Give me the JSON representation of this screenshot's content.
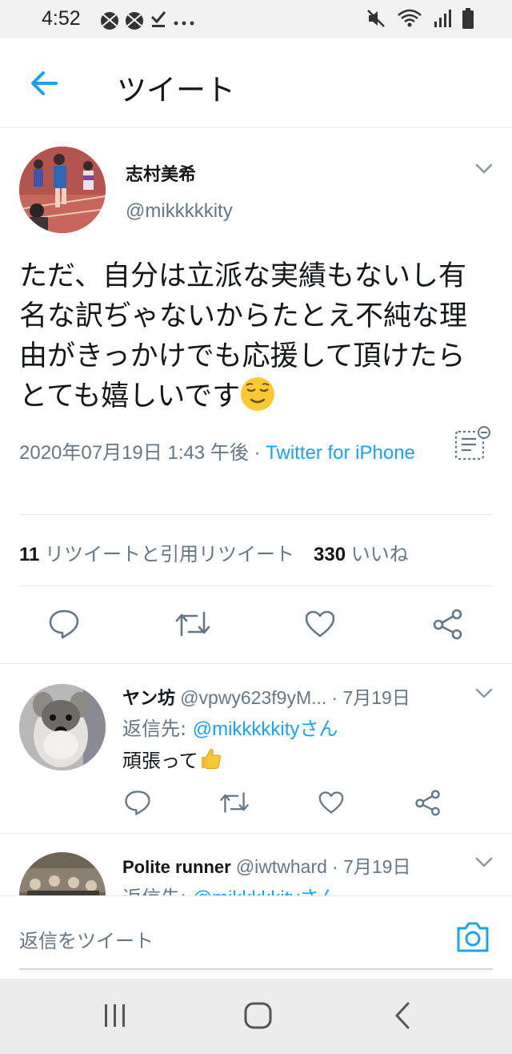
{
  "status_bar": {
    "time": "4:52",
    "icons_left": [
      "soccer-ball-icon",
      "soccer-ball-icon",
      "download-done-icon",
      "more-dots-icon"
    ],
    "icons_right": [
      "mute-icon",
      "wifi-icon",
      "signal-icon",
      "battery-icon"
    ]
  },
  "header": {
    "back_icon": "arrow-left-icon",
    "title": "ツイート",
    "accent_color": "#1da1f2"
  },
  "tweet": {
    "author_name": "志村美希",
    "author_handle": "@mikkkkkity",
    "text": "ただ、自分は立派な実績もないし有名な訳ぢゃないからたとえ不純な理由がきっかけでも応援して頂けたらとても嬉しいです",
    "emoji": "relieved-face-emoji",
    "timestamp": "2020年07月19日 1:43 午後",
    "separator": " · ",
    "source": "Twitter for iPhone",
    "retweet_count": "11",
    "retweet_label": "リツイートと引用リツイート",
    "like_count": "330",
    "like_label": "いいね",
    "actions": [
      "reply-icon",
      "retweet-icon",
      "like-icon",
      "share-icon"
    ]
  },
  "replies": [
    {
      "name": "ヤン坊",
      "handle": "@vpwy623f9yM...",
      "date": "· 7月19日",
      "reply_to_label": "返信先: ",
      "reply_to_mention": "@mikkkkkityさん",
      "text": "頑張って",
      "emoji": "thumbs-up-emoji"
    },
    {
      "name": "Polite runner",
      "handle": "@iwtwhard",
      "date": "· 7月19日",
      "reply_to_label": "返信先: ",
      "reply_to_mention": "@mikkkkkityさん"
    }
  ],
  "composer": {
    "placeholder": "返信をツイート",
    "camera_icon": "camera-icon"
  },
  "nav_bar": {
    "buttons": [
      "recent-apps-icon",
      "home-icon",
      "back-icon"
    ]
  }
}
